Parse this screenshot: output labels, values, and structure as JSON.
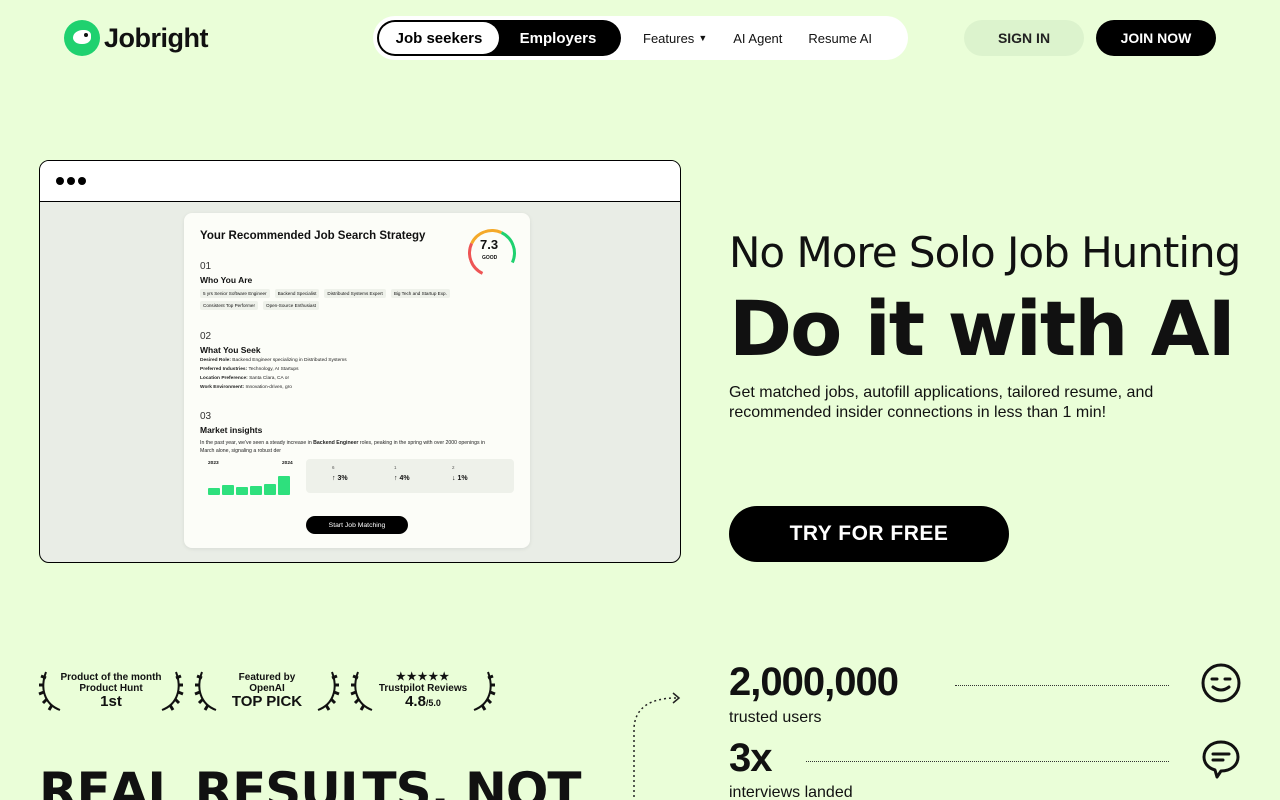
{
  "brand": {
    "name": "Jobright"
  },
  "nav": {
    "segments": [
      "Job seekers",
      "Employers"
    ],
    "links": [
      "Features",
      "AI Agent",
      "Resume AI"
    ],
    "sign_in": "SIGN IN",
    "join": "JOIN NOW"
  },
  "mock": {
    "title": "Your Recommended Job Search Strategy",
    "score": "7.3",
    "score_label": "GOOD",
    "sections": [
      {
        "num": "01",
        "head": "Who You Are"
      },
      {
        "num": "02",
        "head": "What You Seek"
      },
      {
        "num": "03",
        "head": "Market insights"
      }
    ],
    "tags": [
      "5 yrs Senior Software Engineer",
      "Backend Specialist",
      "Distributed Systems Expert",
      "Big Tech and Startup Exp.",
      "Consistent Top Performer",
      "Open-Source Enthusiast"
    ],
    "seek": [
      {
        "label": "Desired Role:",
        "value": "Backend Engineer specializing in Distributed Systems"
      },
      {
        "label": "Preferred Industries:",
        "value": "Technology, AI Startups"
      },
      {
        "label": "Location Preference:",
        "value": "Santa Clara, CA or"
      },
      {
        "label": "Work Environment:",
        "value": "Innovation-driven, gro"
      }
    ],
    "insight_pre": "In the past year, we've seen a steady increase in ",
    "insight_bold": "Backend Engineer",
    "insight_post": " roles, peaking in the spring with over 2000 openings in March alone, signaling a robust der",
    "years": [
      "2023",
      "2024"
    ],
    "bars": [
      0.3,
      0.45,
      0.35,
      0.4,
      0.5,
      0.85
    ],
    "stats": [
      {
        "idx": "6",
        "value": "3%"
      },
      {
        "idx": "1",
        "value": "4%"
      },
      {
        "idx": "2",
        "value": "1%"
      }
    ],
    "button": "Start Job Matching"
  },
  "hero": {
    "line1": "No More Solo Job Hunting",
    "line2": "Do it with AI",
    "sub": "Get matched jobs, autofill applications, tailored resume, and recommended insider connections in less than 1 min!",
    "cta": "TRY FOR FREE"
  },
  "awards": [
    {
      "top": "Product of the month",
      "mid": "Product Hunt",
      "big": "1st"
    },
    {
      "top": "Featured by",
      "mid": "OpenAI",
      "big": "TOP PICK"
    },
    {
      "top": "★★★★★",
      "mid": "Trustpilot Reviews",
      "big": "4.8",
      "small": "/5.0"
    }
  ],
  "real_results": "REAL RESULTS, NOT",
  "stats": [
    {
      "value": "2,000,000",
      "label": "trusted users"
    },
    {
      "value": "3x",
      "label": "interviews landed"
    }
  ],
  "colors": {
    "background": "#eafed8",
    "accent": "#1fd16f",
    "dark": "#000000"
  }
}
